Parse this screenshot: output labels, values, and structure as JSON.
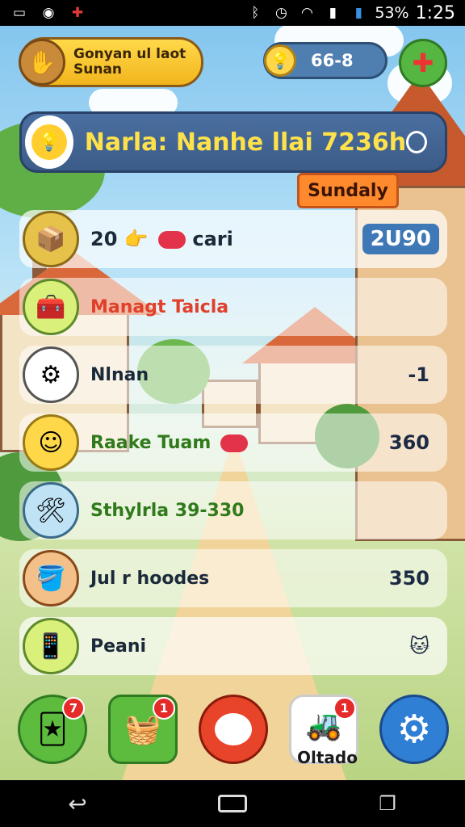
{
  "status_bar": {
    "battery": "53%",
    "time": "1:25"
  },
  "profile": {
    "name_line1": "Gonyan ul laot",
    "name_line2": "Sunan"
  },
  "coins": {
    "value": "66-8"
  },
  "banner": {
    "title": "Narla: Nanhe llai 7236h"
  },
  "ribbon": {
    "label": "Sundaly"
  },
  "list": [
    {
      "label": "20",
      "label_suffix": "cari",
      "value": "2U90",
      "icon": "box-icon"
    },
    {
      "label": "Managt Taicla",
      "value": "",
      "icon": "crate-icon"
    },
    {
      "label": "Nlnan",
      "value": "-1",
      "icon": "gear-bug-icon"
    },
    {
      "label": "Raake Tuam",
      "value": "360",
      "icon": "character-icon"
    },
    {
      "label": "Sthylrla 39-330",
      "value": "",
      "icon": "tools-icon"
    },
    {
      "label": "Jul r hoodes",
      "value": "350",
      "icon": "bucket-icon"
    },
    {
      "label": "Peani",
      "value": "",
      "icon": "phone-icon"
    }
  ],
  "dock": {
    "labels": [
      "Oltado"
    ],
    "badges": [
      "7",
      "1",
      "1"
    ]
  },
  "colors": {
    "accent_yellow": "#ffd94a",
    "banner_blue": "#3c5c88",
    "ribbon_orange": "#ff8a2e",
    "gear_blue": "#2f7fd4"
  }
}
